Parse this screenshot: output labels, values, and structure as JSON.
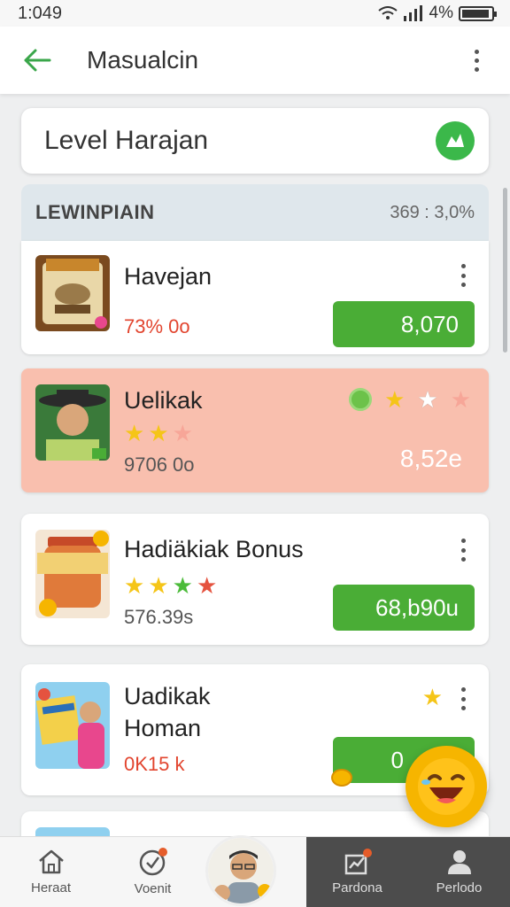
{
  "status": {
    "time": "1:049",
    "battery": "4%"
  },
  "app_bar": {
    "title": "Masualcin"
  },
  "level_card": {
    "title": "Level Harajan"
  },
  "section": {
    "title": "LEWINPIAIN",
    "stat": "369 : 3,0%"
  },
  "items": [
    {
      "name": "Havejan",
      "sub": "73% 0o",
      "price": "8,070"
    },
    {
      "name": "Uelikak",
      "sub": "9706 0o",
      "price": "8,52e"
    },
    {
      "name": "Hadiäkiak Bonus",
      "sub": "576.39s",
      "price": "68,b90u"
    },
    {
      "name_line1": "Uadikak",
      "name_line2": "Homan",
      "sub": "0K15 k",
      "price": "0"
    }
  ],
  "bottom_nav": [
    {
      "label": "Heraat",
      "icon": "home-icon"
    },
    {
      "label": "Voenit",
      "icon": "check-badge-icon"
    },
    {
      "label": "",
      "icon": "profile-avatar"
    },
    {
      "label": "Pardona",
      "icon": "chart-icon"
    },
    {
      "label": "Perlodo",
      "icon": "person-icon"
    }
  ],
  "colors": {
    "accent_green": "#4aad36",
    "badge_green": "#3bb84a",
    "highlight": "#f9bfae",
    "gold": "#f6b500"
  }
}
